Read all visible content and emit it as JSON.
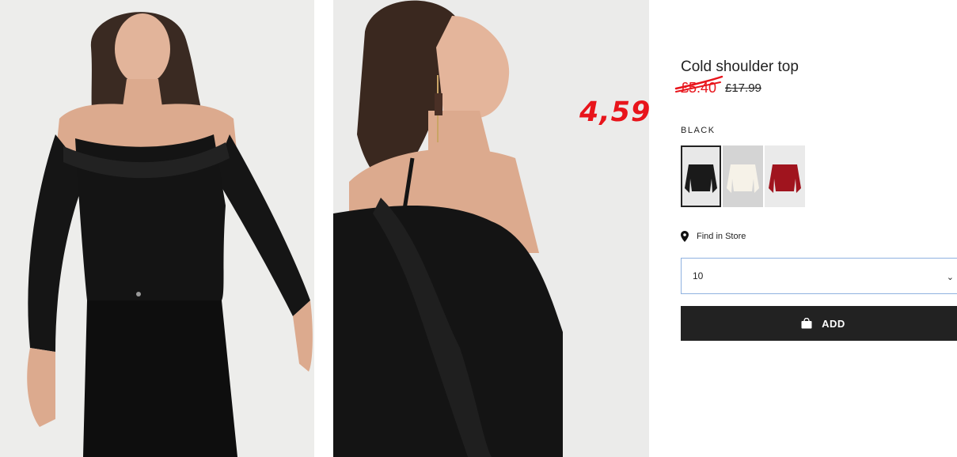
{
  "product": {
    "title": "Cold shoulder top",
    "sale_price": "£5.40",
    "original_price": "£17.99",
    "handwritten_price": "4,59",
    "color_label": "BLACK"
  },
  "swatches": [
    {
      "name": "Black",
      "color": "#1a1a1a",
      "bg": "#e8e8e8",
      "selected": true
    },
    {
      "name": "White",
      "color": "#f6f2e8",
      "bg": "#d4d4d4",
      "selected": false
    },
    {
      "name": "Red",
      "color": "#a0141e",
      "bg": "#eaeaea",
      "selected": false
    }
  ],
  "store": {
    "find_label": "Find in Store"
  },
  "size_select": {
    "value": "10"
  },
  "cart": {
    "add_label": "ADD"
  },
  "colors": {
    "accent_red": "#e8141b",
    "button_bg": "#222222",
    "select_border": "#8fb2e0"
  },
  "icons": [
    "pin-icon",
    "chevron-down-icon",
    "bag-icon"
  ]
}
